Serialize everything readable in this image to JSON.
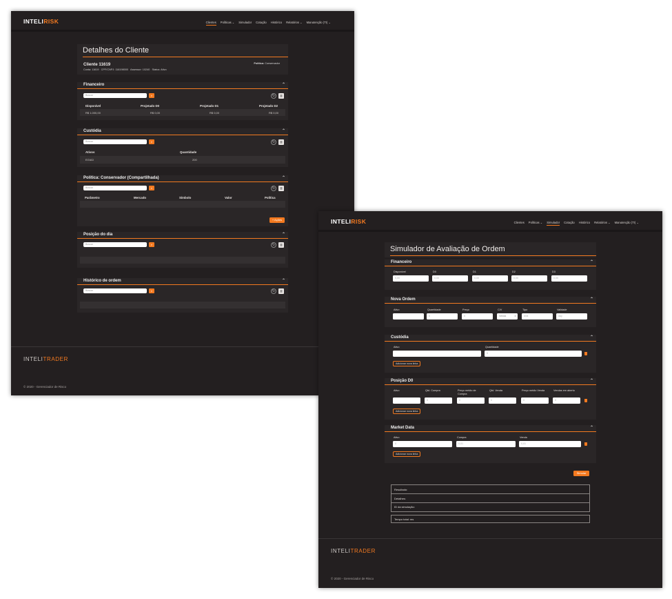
{
  "brand": {
    "part1": "INTELI",
    "part2": "RISK"
  },
  "footer_brand": {
    "part1": "INTELI",
    "part2": "TRADER"
  },
  "copyright": "© 2020 - Gerenciador de Risco",
  "nav1": [
    "Clientes",
    "Políticas ⌄",
    "Simulador",
    "Cotação",
    "Histórico",
    "Relatórios ⌄",
    "Manutenção (TI) ⌄"
  ],
  "nav2": [
    "Clientes",
    "Políticas ⌄",
    "Simulador",
    "Cotação",
    "Histórico",
    "Relatórios ⌄",
    "Manutenção (TI) ⌄"
  ],
  "w1": {
    "title": "Detalhes do Cliente",
    "client_name": "Cliente 11619",
    "client_meta": "Conta: 11619   CPF/CNPJ: 116198000   Assessor: 10240   Status: Ativo",
    "politica_label": "Política:",
    "politica_value": "Conservador",
    "search_placeholder": "Buscar",
    "financeiro": {
      "title": "Financeiro",
      "headers": [
        "Disponível",
        "Projetado D0",
        "Projetado D1",
        "Projetado D2"
      ],
      "values": [
        "R$ 1.000,00",
        "R$ 0,00",
        "R$ 0,00",
        "R$ 0,00"
      ]
    },
    "custodia": {
      "title": "Custódia",
      "headers": [
        "Ativos",
        "Quantidade"
      ],
      "values": [
        "EGIA3",
        "200"
      ]
    },
    "politica": {
      "title": "Política: Conservador (Compartilhada)",
      "headers": [
        "Parâmetro",
        "Mercado",
        "Símbolo",
        "Valor",
        "Política"
      ],
      "add_label": "+ Ações"
    },
    "posicao": {
      "title": "Posição do dia"
    },
    "historico": {
      "title": "Histórico de ordem"
    }
  },
  "w2": {
    "title": "Simulador de Avaliação de Ordem",
    "financeiro": {
      "title": "Financeiro",
      "labels": [
        "Disponível",
        "D0",
        "D1",
        "D2",
        "D3"
      ],
      "values": [
        "0,00",
        "0,00",
        "0,00",
        "0,00",
        "0,00"
      ]
    },
    "nova_ordem": {
      "title": "Nova Ordem",
      "labels": [
        "Ativo",
        "Quantidade",
        "Preço",
        "C/V",
        "Tipo",
        "Validade"
      ],
      "values": [
        "",
        "0",
        "0",
        "Venda",
        "limit",
        "day"
      ]
    },
    "custodia": {
      "title": "Custódia",
      "labels": [
        "Ativo",
        "Quantidade"
      ],
      "qty_value": "0",
      "add_label": "Adicionar nova linha"
    },
    "posicao": {
      "title": "Posição D0",
      "labels": [
        "Ativo",
        "Qtd. Compra",
        "Preço médio de Compra",
        "Qtd. Venda",
        "Preço médio Venda",
        "Vendas em aberto"
      ],
      "values": [
        "",
        "0",
        "0",
        "0",
        "0",
        "0"
      ],
      "add_label": "Adicionar nova linha"
    },
    "market": {
      "title": "Market Data",
      "labels": [
        "Ativo",
        "Compra",
        "Venda"
      ],
      "values": [
        "0",
        "0,01",
        "0,01"
      ],
      "add_label": "Adicionar nova linha"
    },
    "simular_label": "Simular",
    "results": [
      "Resultado:",
      "Detalhes:",
      "ID da simulação:"
    ],
    "tempo": "Tempo total: ms"
  }
}
